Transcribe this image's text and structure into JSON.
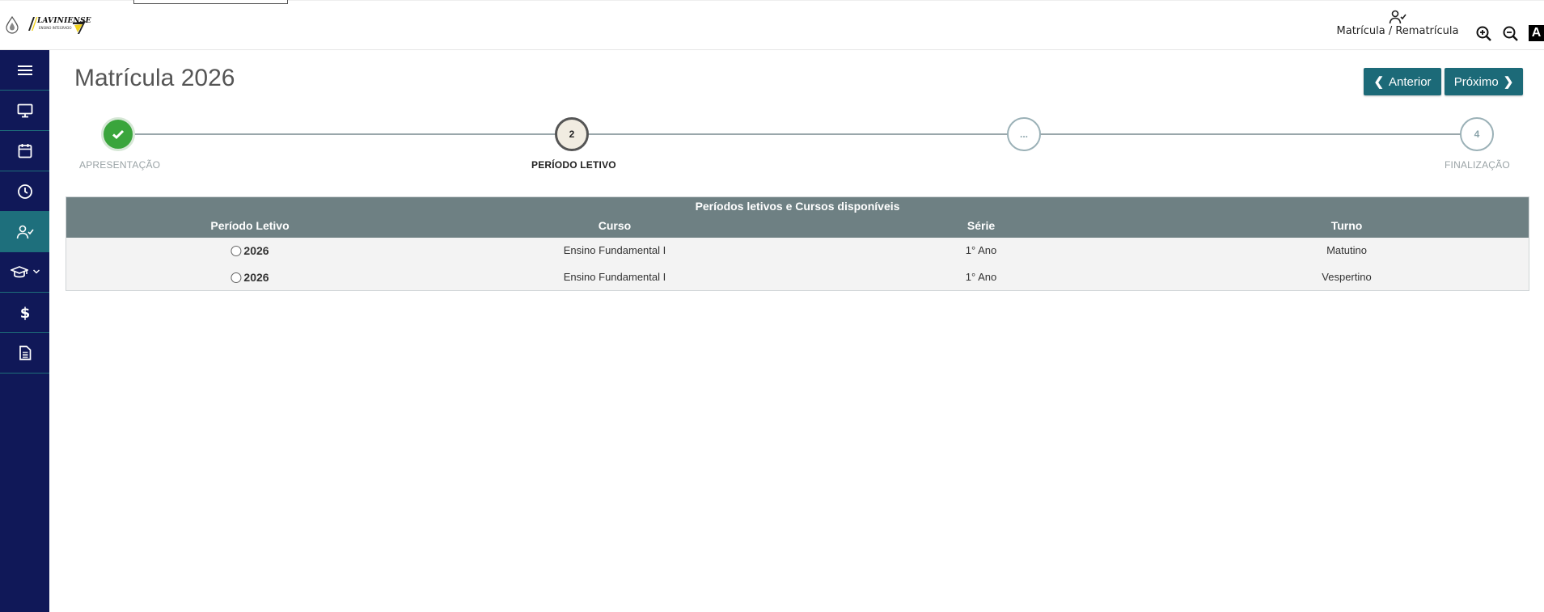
{
  "header": {
    "shortcut_label": "Matrícula / Rematrícula",
    "font_button": "A",
    "brand": {
      "name": "LAVINIENSE",
      "subtitle": "ENSINO INTEGRADO"
    }
  },
  "sidebar": {
    "items": [
      {
        "icon": "menu-icon"
      },
      {
        "icon": "monitor-icon"
      },
      {
        "icon": "calendar-icon"
      },
      {
        "icon": "clock-icon"
      },
      {
        "icon": "user-check-icon",
        "active": true
      },
      {
        "icon": "graduation-cap-icon"
      },
      {
        "icon": "dollar-icon"
      },
      {
        "icon": "document-icon"
      }
    ]
  },
  "page": {
    "title": "Matrícula 2026",
    "prev_label": "Anterior",
    "next_label": "Próximo"
  },
  "stepper": {
    "steps": [
      {
        "marker": "",
        "label": "APRESENTAÇÃO",
        "state": "done"
      },
      {
        "marker": "2",
        "label": "PERÍODO LETIVO",
        "state": "current"
      },
      {
        "marker": "...",
        "label": "",
        "state": "pending"
      },
      {
        "marker": "4",
        "label": "FINALIZAÇÃO",
        "state": "pending"
      }
    ]
  },
  "table": {
    "caption": "Períodos letivos e Cursos disponíveis",
    "columns": [
      "Período Letivo",
      "Curso",
      "Série",
      "Turno"
    ],
    "rows": [
      {
        "periodo": "2026",
        "curso": "Ensino Fundamental I",
        "serie": "1° Ano",
        "turno": "Matutino"
      },
      {
        "periodo": "2026",
        "curso": "Ensino Fundamental I",
        "serie": "1° Ano",
        "turno": "Vespertino"
      }
    ]
  },
  "colors": {
    "sidebar_bg": "#101858",
    "sidebar_active": "#1e6f7c",
    "button_bg": "#1c6a78",
    "table_header_bg": "#6e8083",
    "step_done": "#3aa53c"
  }
}
